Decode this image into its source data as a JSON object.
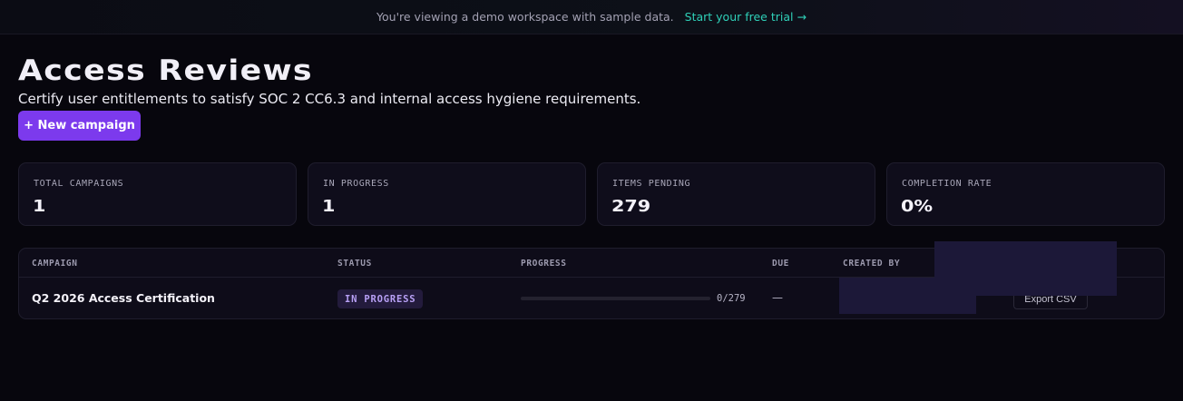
{
  "banner": {
    "text": "You're viewing a demo workspace with sample data.",
    "link_label": "Start your free trial →"
  },
  "page": {
    "title": "Access Reviews",
    "subtitle": "Certify user entitlements to satisfy SOC 2 CC6.3 and internal access hygiene requirements.",
    "new_button_label": "+ New campaign"
  },
  "stats": [
    {
      "label": "TOTAL CAMPAIGNS",
      "value": "1"
    },
    {
      "label": "IN PROGRESS",
      "value": "1"
    },
    {
      "label": "ITEMS PENDING",
      "value": "279"
    },
    {
      "label": "COMPLETION RATE",
      "value": "0%"
    }
  ],
  "table": {
    "columns": [
      "CAMPAIGN",
      "STATUS",
      "PROGRESS",
      "DUE",
      "CREATED BY"
    ],
    "rows": [
      {
        "campaign": "Q2 2026 Access Certification",
        "status": "IN PROGRESS",
        "progress_fraction": 0,
        "progress_text": "0/279",
        "due": "—",
        "action_label": "Export CSV"
      }
    ]
  },
  "colors": {
    "accent": "#7c3aed",
    "link": "#2fd0b8",
    "background": "#07060d",
    "status_text": "#b8a0f5"
  }
}
